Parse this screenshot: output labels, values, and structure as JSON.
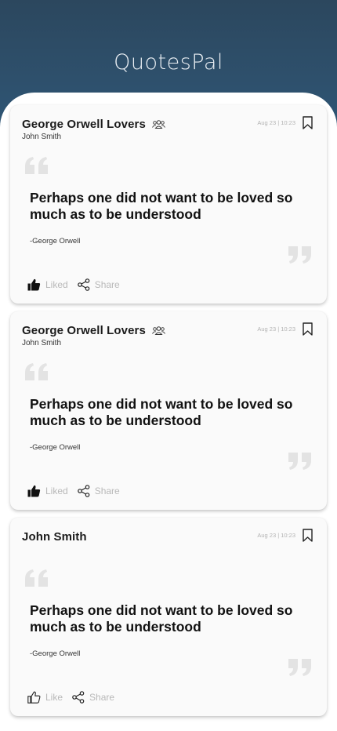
{
  "app": {
    "title": "QuotesPal"
  },
  "colors": {
    "header": "#2c475e",
    "accent_text": "#e9eef3",
    "quote_mark": "#e3e3e3"
  },
  "cards": [
    {
      "title": "George Orwell Lovers",
      "has_group_icon": true,
      "subtitle": "John Smith",
      "date": "Aug 23 | 10:23",
      "quote": "Perhaps one did not want to be loved so much as to be understood",
      "author": "-George Orwell",
      "like_label": "Liked",
      "liked": true,
      "share_label": "Share"
    },
    {
      "title": "George Orwell Lovers",
      "has_group_icon": true,
      "subtitle": "John Smith",
      "date": "Aug 23 | 10:23",
      "quote": "Perhaps one did not want to be loved so much as to be understood",
      "author": "-George Orwell",
      "like_label": "Liked",
      "liked": true,
      "share_label": "Share"
    },
    {
      "title": "John Smith",
      "has_group_icon": false,
      "subtitle": "",
      "date": "Aug 23 | 10:23",
      "quote": "Perhaps one did not want to be loved so much as to be understood",
      "author": "-George Orwell",
      "like_label": "Like",
      "liked": false,
      "share_label": "Share"
    }
  ]
}
